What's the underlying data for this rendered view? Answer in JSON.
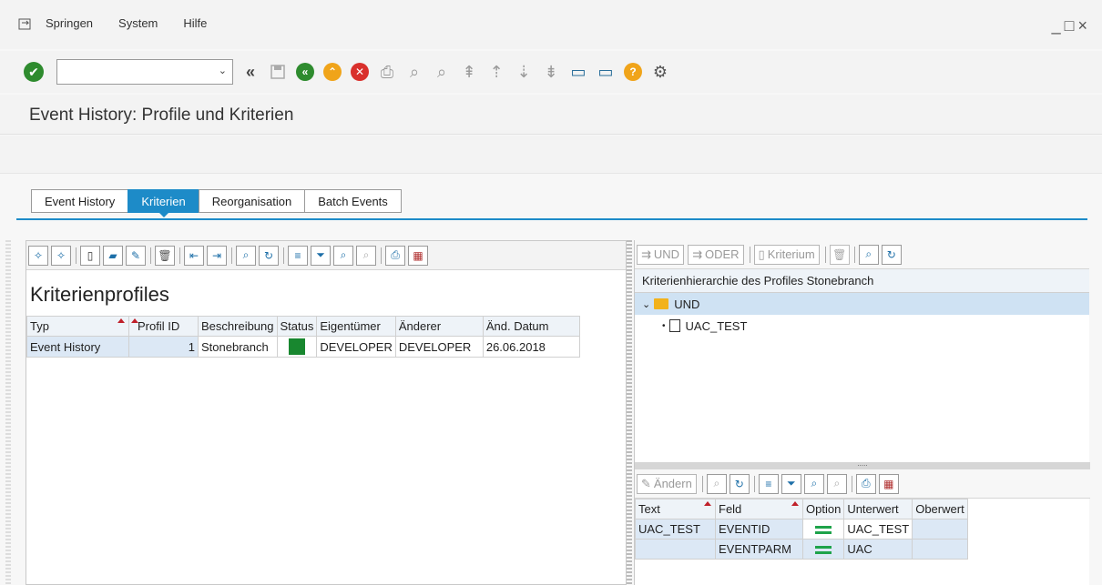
{
  "menu": {
    "items": [
      "Springen",
      "System",
      "Hilfe"
    ],
    "window_controls": "_□×"
  },
  "toolbar": {
    "ok_icon": "✔",
    "command_field_value": "",
    "dropdown_glyph": "⌄"
  },
  "title": "Event History: Profile und Kriterien",
  "tabs": [
    {
      "label": "Event History",
      "active": false
    },
    {
      "label": "Kriterien",
      "active": true
    },
    {
      "label": "Reorganisation",
      "active": false
    },
    {
      "label": "Batch Events",
      "active": false
    }
  ],
  "left": {
    "title": "Kriterienprofiles",
    "columns": [
      "Typ",
      "Profil ID",
      "Beschreibung",
      "Status",
      "Eigentümer",
      "Änderer",
      "Änd. Datum"
    ],
    "rows": [
      {
        "typ": "Event History",
        "profil_id": "1",
        "beschreibung": "Stonebranch",
        "status": "green",
        "eigentuemer": "DEVELOPER",
        "aenderer": "DEVELOPER",
        "datum": "26.06.2018"
      }
    ]
  },
  "right": {
    "toolbar": {
      "und": "UND",
      "oder": "ODER",
      "kriterium": "Kriterium"
    },
    "tree_header": "Kriterienhierarchie des Profiles Stonebranch",
    "tree": {
      "root": "UND",
      "child": "UAC_TEST"
    },
    "lower_toolbar": {
      "aendern": "Ändern"
    },
    "columns": [
      "Text",
      "Feld",
      "Option",
      "Unterwert",
      "Oberwert"
    ],
    "rows": [
      {
        "text": "UAC_TEST",
        "feld": "EVENTID",
        "option": "=",
        "unterwert": "UAC_TEST",
        "oberwert": ""
      },
      {
        "text": "",
        "feld": "EVENTPARM",
        "option": "=",
        "unterwert": "UAC",
        "oberwert": ""
      }
    ]
  },
  "colors": {
    "accent": "#1d8bc8",
    "status_green": "#18872f",
    "ok_green": "#2e8b2e",
    "cancel_red": "#d9302c",
    "nav_orange": "#f0a41a"
  }
}
